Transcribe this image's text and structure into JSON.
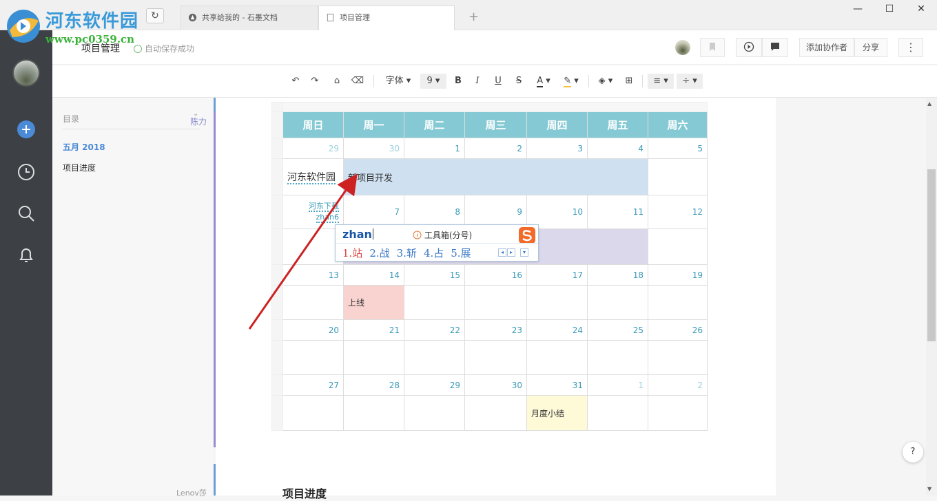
{
  "watermark": {
    "title": "河东软件园",
    "url": "www.pc0359.cn"
  },
  "tabs": [
    {
      "label": "共享给我的 - 石墨文档"
    },
    {
      "label": "项目管理"
    }
  ],
  "tab_new": "+",
  "window_controls": {
    "minimize": "—",
    "maximize": "☐",
    "close": "✕"
  },
  "header": {
    "doc_title": "项目管理",
    "save_status": "自动保存成功",
    "add_collaborator": "添加协作者",
    "share": "分享",
    "more": "⋮"
  },
  "toolbar": {
    "font": "字体",
    "font_size": "9",
    "bold": "B",
    "italic": "I",
    "underline": "U",
    "strike": "S",
    "font_color": "A"
  },
  "toc": {
    "label": "目录",
    "user": "陈力",
    "items": [
      "五月 2018",
      "项目进度"
    ],
    "bottom_user": "Lenov莎"
  },
  "calendar": {
    "days": [
      "周日",
      "周一",
      "周二",
      "周三",
      "周四",
      "周五",
      "周六"
    ],
    "weeks": [
      {
        "nums": [
          "29",
          "30",
          "1",
          "2",
          "3",
          "4",
          "5"
        ],
        "event_label": "河东软件园",
        "event": "新项目开发"
      },
      {
        "nums": [
          "",
          "7",
          "8",
          "9",
          "10",
          "11",
          "12"
        ],
        "note1": "河东下载",
        "note2": "zhan6"
      },
      {
        "nums": [
          "13",
          "14",
          "15",
          "16",
          "17",
          "18",
          "19"
        ],
        "event": "上线"
      },
      {
        "nums": [
          "20",
          "21",
          "22",
          "23",
          "24",
          "25",
          "26"
        ]
      },
      {
        "nums": [
          "27",
          "28",
          "29",
          "30",
          "31",
          "1",
          "2"
        ],
        "event": "月度小结"
      }
    ]
  },
  "ime": {
    "input": "zhan",
    "tool": "工具箱(分号)",
    "candidates": [
      "1.站",
      "2.战",
      "3.斩",
      "4.占",
      "5.展"
    ]
  },
  "section_heading": "项目进度",
  "help": "?",
  "colors": {
    "header_teal": "#84c9d3",
    "event_blue": "#cfe0f1",
    "event_purple": "#dcd8ec",
    "event_pink": "#f8d3d0",
    "event_yellow": "#fefad8",
    "sidebar": "#3d4145",
    "accent": "#4a8ad6",
    "arrow": "#cc2222"
  }
}
